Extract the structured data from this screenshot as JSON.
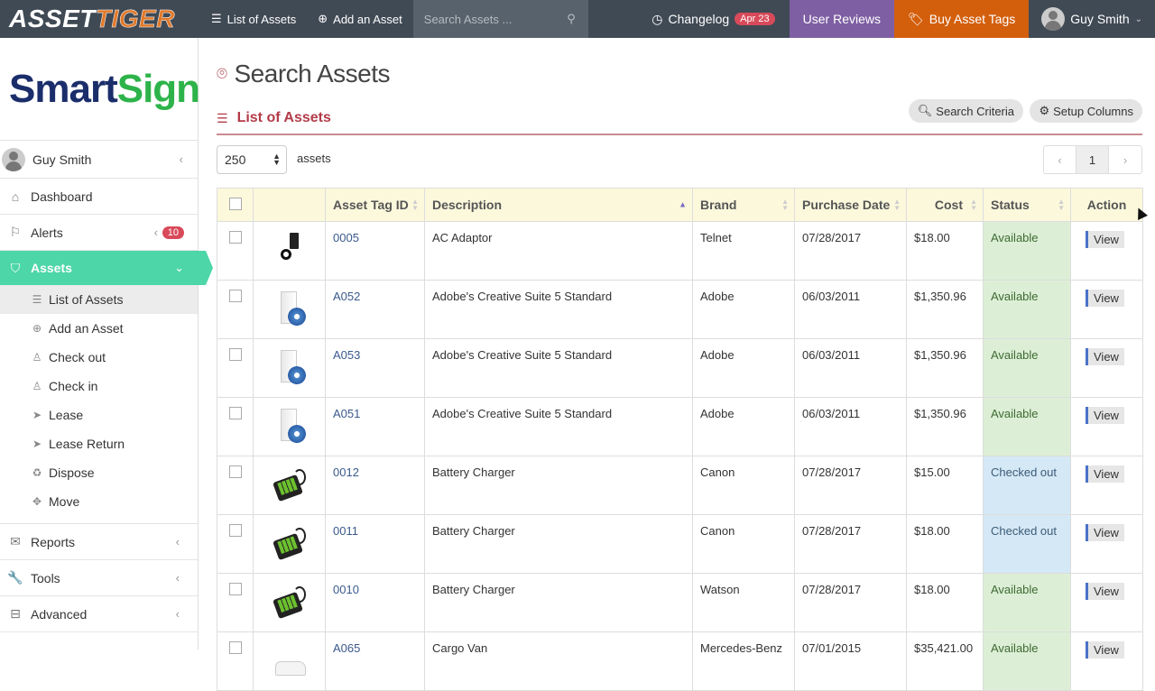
{
  "topbar": {
    "logo_part1": "ASSET",
    "logo_part2": "TIGER",
    "nav_list": "List of Assets",
    "nav_add": "Add an Asset",
    "search_placeholder": "Search Assets ...",
    "changelog": "Changelog",
    "changelog_badge": "Apr 23",
    "user_reviews": "User Reviews",
    "buy_tags": "Buy Asset Tags",
    "user_name": "Guy Smith"
  },
  "sidebar": {
    "brand_part1": "Smart",
    "brand_part2": "Sign",
    "user_name": "Guy Smith",
    "dashboard": "Dashboard",
    "alerts": "Alerts",
    "alerts_count": "10",
    "assets": "Assets",
    "sub_items": [
      {
        "label": "List of Assets",
        "icon": "list-icon"
      },
      {
        "label": "Add an Asset",
        "icon": "plus-circle-icon"
      },
      {
        "label": "Check out",
        "icon": "user-icon"
      },
      {
        "label": "Check in",
        "icon": "user-icon"
      },
      {
        "label": "Lease",
        "icon": "send-icon"
      },
      {
        "label": "Lease Return",
        "icon": "send-icon"
      },
      {
        "label": "Dispose",
        "icon": "recycle-icon"
      },
      {
        "label": "Move",
        "icon": "move-icon"
      }
    ],
    "reports": "Reports",
    "tools": "Tools",
    "advanced": "Advanced"
  },
  "main": {
    "page_title": "Search Assets",
    "section_title": "List of Assets",
    "search_criteria": "Search Criteria",
    "setup_columns": "Setup Columns",
    "per_page": "250",
    "per_page_label": "assets",
    "pager": {
      "prev": "‹",
      "current": "1",
      "next": "›"
    },
    "columns": [
      "",
      "",
      "Asset Tag ID",
      "Description",
      "Brand",
      "Purchase Date",
      "Cost",
      "Status",
      "Action"
    ],
    "rows": [
      {
        "tag": "0005",
        "description": "AC Adaptor",
        "brand": "Telnet",
        "date": "07/28/2017",
        "cost": "$18.00",
        "status": "Available",
        "action": "View",
        "image": "adaptor"
      },
      {
        "tag": "A052",
        "description": "Adobe's Creative Suite 5 Standard",
        "brand": "Adobe",
        "date": "06/03/2011",
        "cost": "$1,350.96",
        "status": "Available",
        "action": "View",
        "image": "software-box"
      },
      {
        "tag": "A053",
        "description": "Adobe's Creative Suite 5 Standard",
        "brand": "Adobe",
        "date": "06/03/2011",
        "cost": "$1,350.96",
        "status": "Available",
        "action": "View",
        "image": "software-box"
      },
      {
        "tag": "A051",
        "description": "Adobe's Creative Suite 5 Standard",
        "brand": "Adobe",
        "date": "06/03/2011",
        "cost": "$1,350.96",
        "status": "Available",
        "action": "View",
        "image": "software-box"
      },
      {
        "tag": "0012",
        "description": "Battery Charger",
        "brand": "Canon",
        "date": "07/28/2017",
        "cost": "$15.00",
        "status": "Checked out",
        "action": "View",
        "image": "charger"
      },
      {
        "tag": "0011",
        "description": "Battery Charger",
        "brand": "Canon",
        "date": "07/28/2017",
        "cost": "$18.00",
        "status": "Checked out",
        "action": "View",
        "image": "charger"
      },
      {
        "tag": "0010",
        "description": "Battery Charger",
        "brand": "Watson",
        "date": "07/28/2017",
        "cost": "$18.00",
        "status": "Available",
        "action": "View",
        "image": "charger"
      },
      {
        "tag": "A065",
        "description": "Cargo Van",
        "brand": "Mercedes-Benz",
        "date": "07/01/2015",
        "cost": "$35,421.00",
        "status": "Available",
        "action": "View",
        "image": "van"
      }
    ]
  },
  "colors": {
    "topbar": "#404a55",
    "reviews": "#7e5fa3",
    "buy_tags": "#d35f0d",
    "sidebar_active": "#4dd6a8",
    "accent_red": "#b33b49",
    "available_bg": "#dcefd6",
    "checked_out_bg": "#d5e8f5"
  }
}
